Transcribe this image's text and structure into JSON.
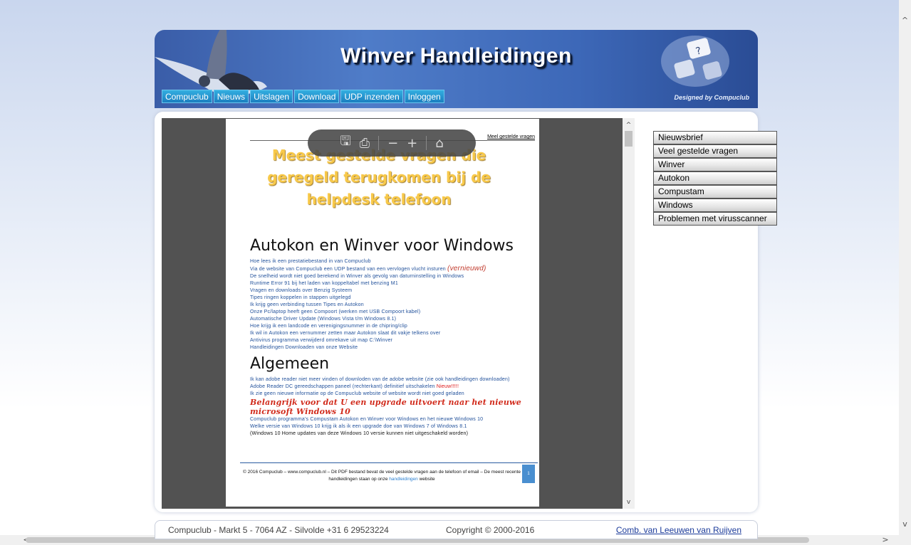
{
  "header": {
    "title": "Winver Handleidingen",
    "designed_by": "Designed by Compuclub",
    "nav": [
      "Compuclub",
      "Nieuws",
      "Uitslagen",
      "Download",
      "UDP inzenden",
      "Inloggen"
    ]
  },
  "pdf": {
    "header_link": "Meel gestelde vragen",
    "title": "Meest gestelde vragen die geregeld terugkomen bij de helpdesk telefoon",
    "section1": {
      "heading": "Autokon en Winver voor Windows",
      "items": [
        "Hoe lees ik een prestatiebestand in van Compuclub",
        "Via de website van Compuclub een UDP bestand van een vervlogen vlucht insturen",
        "De snelheid wordt niet goed berekend in Winver als gevolg van daturninstelling in Windows",
        "Runtime Error 91 bij het laden van koppeltabel met benzing M1",
        "Vragen en downloads over Benzig Systeem",
        "Tipes ringen koppelen in stappen uitgelegd",
        "Ik krijg geen verbinding tussen Tipes en Autokon",
        "Onze Pc/laptop heeft geen Compoort (werken met USB Compoort kabel)",
        "Automatische Driver Update (Windows Vista t/m Windows 8.1)",
        "Hoe krijg ik een landcode en verenigingsnummer in de chipring/clip",
        "Ik wil in Autokon een vernummer zetten maar Autokon slaat dit vakje telkens over",
        "Antivirus programma verwijderd omrekave uit map C:\\Winver",
        "Handleidingen Downloaden van onze Website"
      ],
      "new_tag": "(vernieuwd)"
    },
    "section2": {
      "heading": "Algemeen",
      "items": [
        "Ik kan adobe reader niet meer vinden of downloden van de adobe website (zie ook handleidingen downloaden)",
        "Adobe Reader DC gereedschappen paneel (rechterkant) definitief uitschakelen",
        "Ik zie geen nieuwe informatie op de Compuclub website of website wordt niet goed geladen",
        "Compuclub programma's Compustam Autokon en Winver voor Windows en het nieuwe Windows 10",
        "Welke versie van Windows 10 krijg ik als ik een upgrade doe van Windows 7 of Windows 8.1",
        "(Windows 10 Home updates van deze Windows 10 versie kunnen niet uitgeschakeld worden)"
      ],
      "new_tag": "Nieuw!!!!!",
      "important": "Belangrijk voor dat U een upgrade uitvoert naar het nieuwe microsoft Windows 10"
    },
    "footer_text": "© 2016 Compuclub – www.compuclub.nl – Dit PDF bestand bevat de veel gestelde vragen aan de telefoon of email – De meest recente handleidingen staan op onze",
    "footer_link": "handleidingen",
    "footer_end": "website",
    "page_number": "1"
  },
  "sidemenu": [
    "Nieuwsbrief",
    "Veel gestelde vragen",
    "Winver",
    "Autokon",
    "Compustam",
    "Windows",
    "Problemen met virusscanner"
  ],
  "footer": {
    "address": "Compuclub - Markt 5  - 7064 AZ  - Silvolde  +31 6 29523224",
    "copyright": "Copyright © 2000-2016",
    "credit": "Comb. van Leeuwen van Ruijven"
  }
}
